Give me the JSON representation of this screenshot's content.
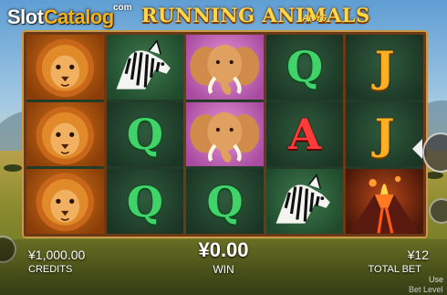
{
  "logo": {
    "site_white": "Slot",
    "site_accent": "Catalog",
    "site_suffix": "com"
  },
  "game": {
    "title": "RUNNING ANIMALS",
    "badge": "ANY6"
  },
  "reels": [
    [
      "lion",
      "lion",
      "lion"
    ],
    [
      "zebra",
      "Q",
      "Q"
    ],
    [
      "elephant",
      "elephant",
      "Q"
    ],
    [
      "Q",
      "A",
      "zebra"
    ],
    [
      "J",
      "J",
      "volcano"
    ]
  ],
  "footer": {
    "credits_value": "¥1,000.00",
    "credits_label": "CREDITS",
    "win_value": "¥0.00",
    "win_label": "WIN",
    "bet_value": "¥12",
    "bet_label": "TOTAL BET",
    "use_text": "Use",
    "bet_level_text": "Bet Level"
  },
  "icons": [
    "menu-button-icon",
    "spin-button-icon",
    "autoplay-icon"
  ]
}
